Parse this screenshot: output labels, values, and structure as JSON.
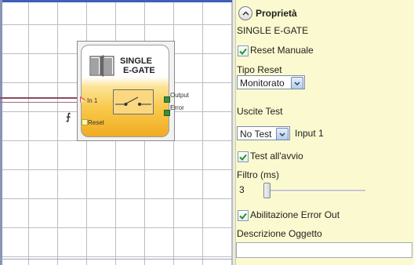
{
  "block": {
    "title_line1": "SINGLE",
    "title_line2": "E-GATE",
    "pin_in1": "In 1",
    "pin_reset": "Reset",
    "pin_output": "Output",
    "pin_error": "Error",
    "gate_icon": "gate-icon",
    "switch_icon": "switch-icon"
  },
  "canvas": {
    "pulse_glyph": "⨍"
  },
  "panel": {
    "title": "Proprietà",
    "collapse_icon": "chevron-up-icon",
    "object_name": "SINGLE E-GATE",
    "reset_manuale": {
      "label": "Reset Manuale",
      "checked": true
    },
    "tipo_reset": {
      "label": "Tipo Reset",
      "value": "Monitorato"
    },
    "uscite_test": {
      "label": "Uscite Test",
      "value": "No Test",
      "suffix": "Input 1"
    },
    "test_avvio": {
      "label": "Test all'avvio",
      "checked": true
    },
    "filtro": {
      "label": "Filtro (ms)",
      "value": "3"
    },
    "abilitazione_error": {
      "label": "Abilitazione Error Out",
      "checked": true
    },
    "descrizione": {
      "label": "Descrizione Oggetto",
      "value": ""
    }
  },
  "colors": {
    "panel_bg": "#fbf9cf",
    "block_orange": "#f1ab22",
    "pin_in_color": "#e0457b",
    "output_pin_color": "#3b8f3b",
    "wire_color": "#8a4b60"
  }
}
